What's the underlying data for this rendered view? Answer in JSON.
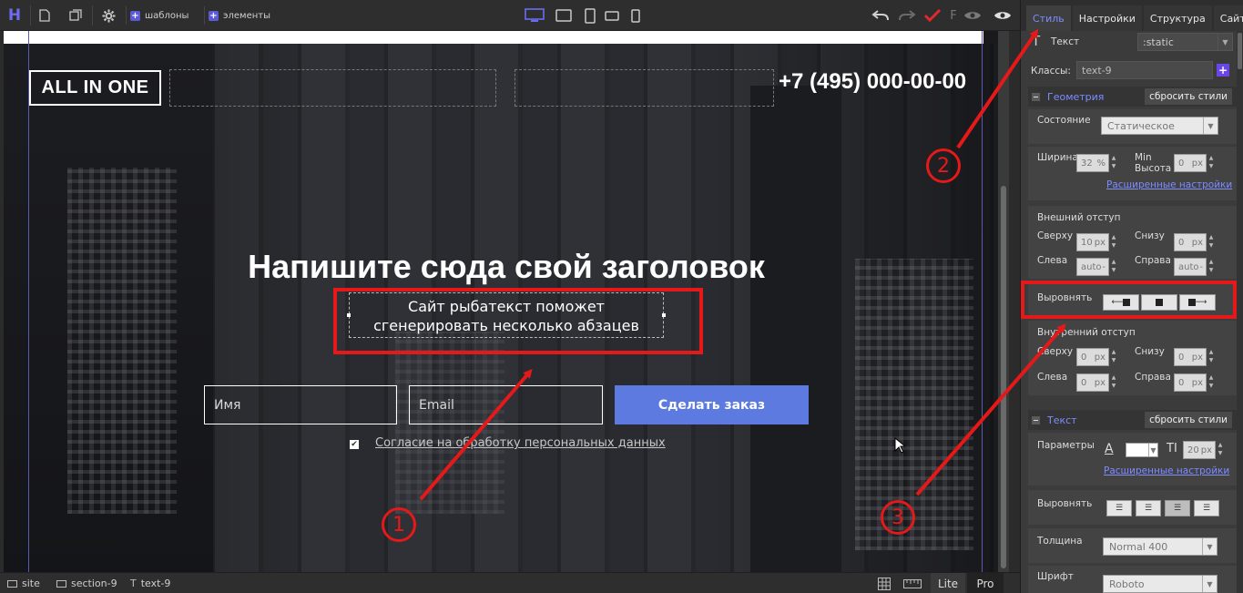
{
  "toolbar": {
    "logo": "H",
    "templates_label": "шаблоны",
    "elements_label": "элементы"
  },
  "canvas": {
    "logo_text": "ALL IN ONE",
    "phone": "+7 (495) 000-00-00",
    "headline": "Напишите сюда свой заголовок",
    "subtext_line1": "Сайт рыбатекст поможет",
    "subtext_line2": "сгенерировать несколько абзацев",
    "name_placeholder": "Имя",
    "email_placeholder": "Email",
    "order_button": "Сделать заказ",
    "consent_text": "Согласие на обработку персональных данных"
  },
  "annotations": {
    "n1": "1",
    "n2": "2",
    "n3": "3"
  },
  "bottombar": {
    "crumbs": [
      "site",
      "section-9",
      "text-9"
    ],
    "lite": "Lite",
    "pro": "Pro"
  },
  "panel": {
    "tabs": [
      "Стиль",
      "Настройки",
      "Структура",
      "Сайт"
    ],
    "element_type": "Текст",
    "position_select": ":static",
    "classes_label": "Классы:",
    "classes_value": "text-9",
    "geometry": {
      "title": "Геометрия",
      "reset": "сбросить стили",
      "state_label": "Состояние",
      "state_value": "Статическое",
      "width_label": "Ширина",
      "width_value": "32",
      "width_unit": "%",
      "minheight_label_1": "Min",
      "minheight_label_2": "Высота",
      "minheight_value": "0",
      "minheight_unit": "px",
      "advanced": "Расширенные настройки",
      "margin_label": "Внешний отступ",
      "top_label": "Сверху",
      "top_value": "10",
      "bottom_label": "Снизу",
      "bottom_value": "0",
      "left_label": "Слева",
      "left_value": "auto",
      "right_label": "Справа",
      "right_value": "auto",
      "unit_px": "px",
      "align_label": "Выровнять",
      "padding_label": "Внутренний отступ",
      "p_top_label": "Сверху",
      "p_top_value": "0",
      "p_bottom_label": "Снизу",
      "p_bottom_value": "0",
      "p_left_label": "Слева",
      "p_left_value": "0",
      "p_right_label": "Справа",
      "p_right_value": "0"
    },
    "text": {
      "title": "Текст",
      "reset": "сбросить стили",
      "params_label": "Параметры",
      "font_size_value": "20",
      "font_size_unit": "px",
      "advanced": "Расширенные настройки",
      "align_label": "Выровнять",
      "weight_label": "Толщина",
      "weight_value": "Normal 400",
      "font_label": "Шрифт",
      "font_value": "Roboto"
    }
  },
  "colors": {
    "accent": "#7d8cff",
    "button": "#5c7ae0",
    "annotation": "#e51919"
  }
}
